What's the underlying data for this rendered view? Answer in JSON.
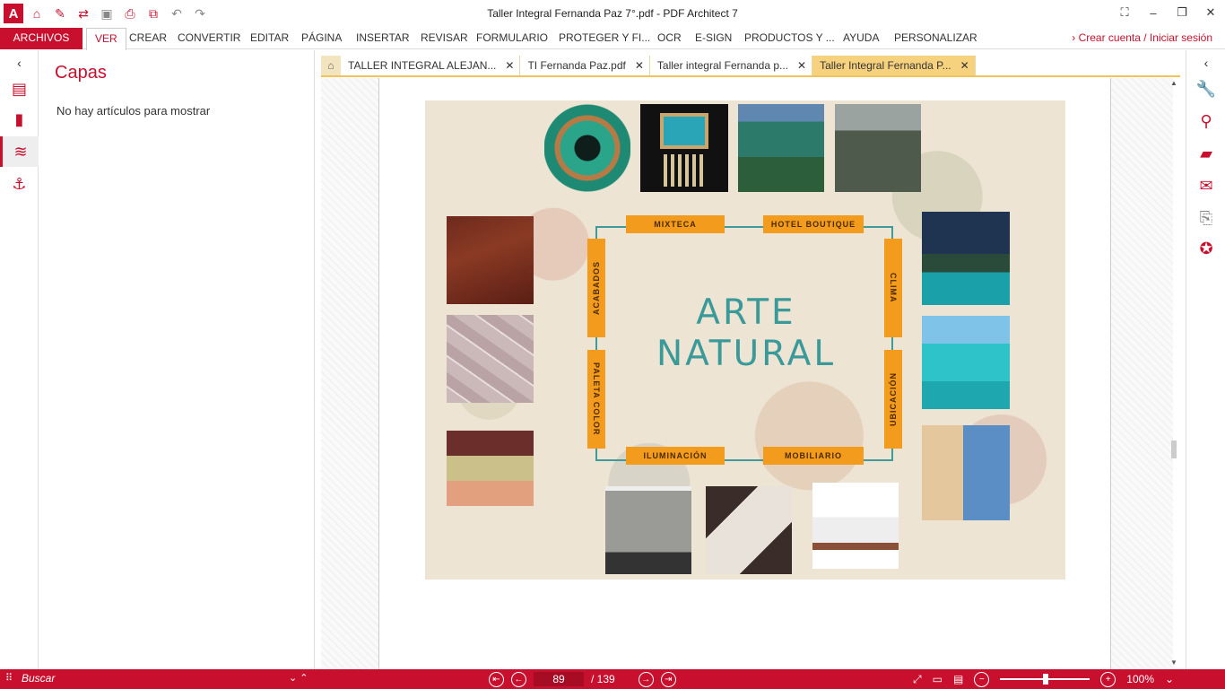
{
  "window": {
    "title": "Taller Integral Fernanda Paz 7°.pdf   -   PDF Architect 7",
    "controls": [
      "⛶",
      "–",
      "❐",
      "✕"
    ]
  },
  "qat": {
    "logo": "A",
    "icons": [
      "home-icon",
      "eraser-icon",
      "convert-icon",
      "save-icon",
      "print-icon",
      "scan-icon",
      "undo-icon",
      "redo-icon"
    ]
  },
  "ribbon": {
    "tabs": [
      "ARCHIVOS",
      "VER",
      "CREAR",
      "CONVERTIR",
      "EDITAR",
      "PÁGINA",
      "INSERTAR",
      "REVISAR",
      "FORMULARIO",
      "PROTEGER Y FI...",
      "OCR",
      "E-SIGN",
      "PRODUCTOS Y ...",
      "AYUDA",
      "PERSONALIZAR"
    ],
    "active_tab": "VER",
    "account": "Crear cuenta / Iniciar sesión"
  },
  "panel": {
    "title": "Capas",
    "empty": "No hay artículos para mostrar"
  },
  "doc_tabs": [
    {
      "label": "TALLER INTEGRAL ALEJAN...",
      "active": false
    },
    {
      "label": "TI Fernanda Paz.pdf",
      "active": false
    },
    {
      "label": "Taller integral Fernanda p...",
      "active": false
    },
    {
      "label": "Taller Integral Fernanda P...",
      "active": true
    }
  ],
  "slide": {
    "title_line1": "ARTE",
    "title_line2": "NATURAL",
    "labels": {
      "top_left": "MIXTECA",
      "top_right": "HOTEL BOUTIQUE",
      "left_top": "ACABADOS",
      "left_bottom": "PALETA COLOR",
      "right_top": "CLIMA",
      "right_bottom": "UBICACIÓN",
      "bottom_left": "ILUMINACIÓN",
      "bottom_right": "MOBILIARIO"
    },
    "palette": [
      "#6b2e2a",
      "#cbc08a",
      "#e3a07e"
    ],
    "accent": "#3a9a9a",
    "label_color": "#f29b1d"
  },
  "status": {
    "search_placeholder": "Buscar",
    "page": "89",
    "total": "/ 139",
    "zoom": "100%"
  },
  "colors": {
    "brand": "#c8102e",
    "tab_active": "#f7d27e"
  }
}
